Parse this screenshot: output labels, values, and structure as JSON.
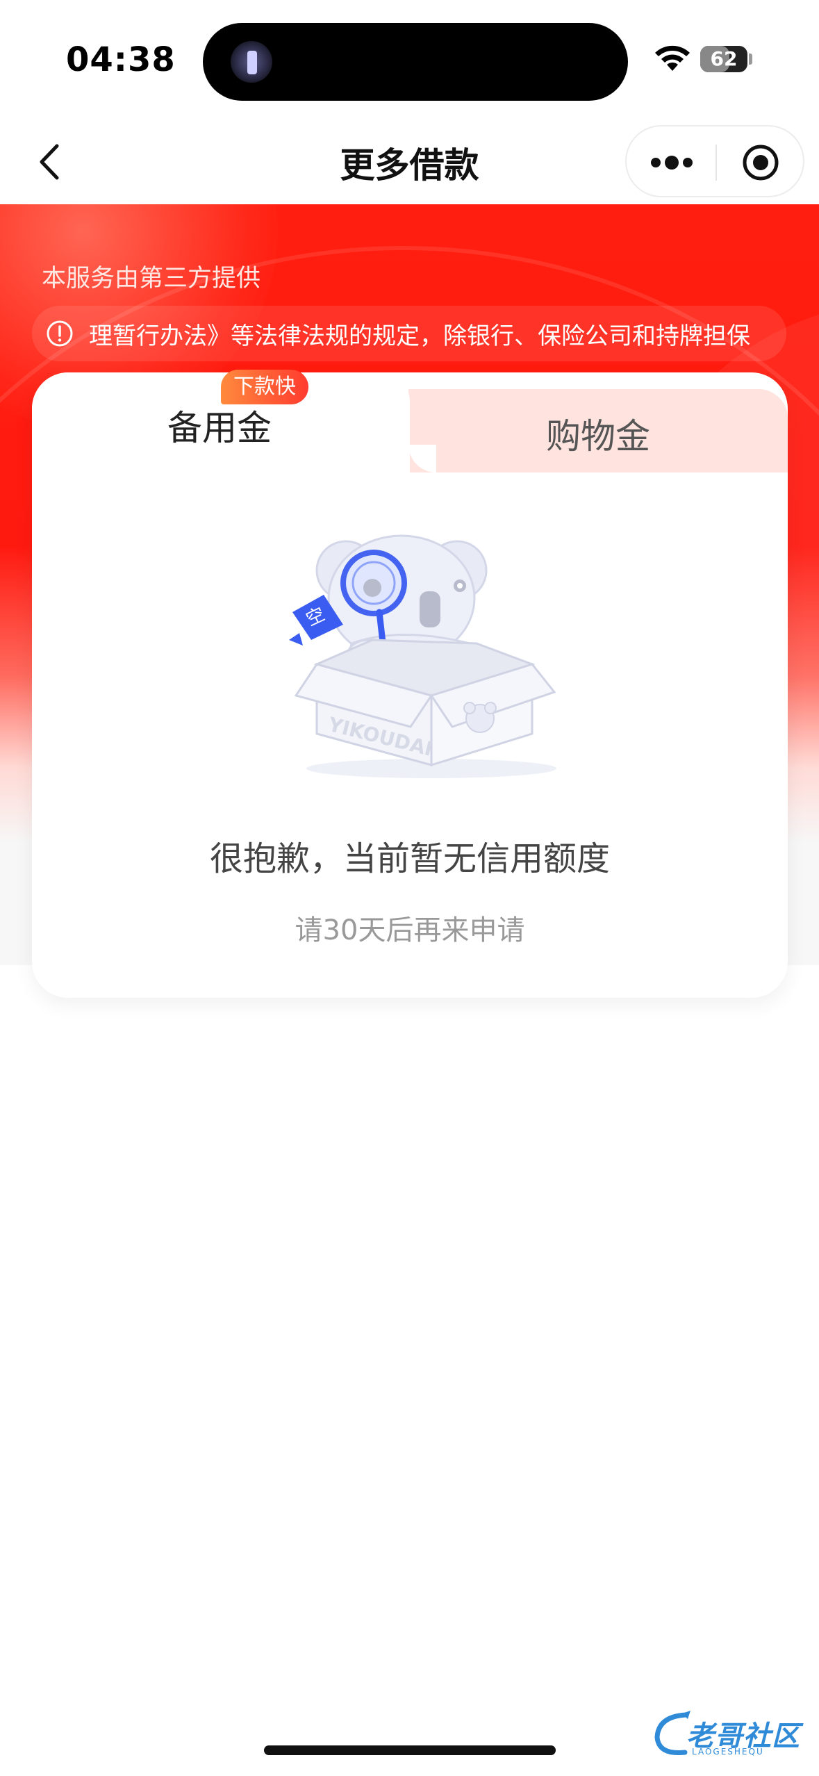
{
  "status_bar": {
    "time": "04:38",
    "battery": "62",
    "battery_level": 0.62,
    "icons": [
      "flashlight-icon",
      "wifi-icon",
      "battery-icon"
    ]
  },
  "navbar": {
    "title": "更多借款",
    "icons": [
      "back-chevron-icon",
      "more-dots-icon",
      "target-icon"
    ]
  },
  "hero": {
    "provider_text": "本服务由第三方提供",
    "notice_text": "理暂行办法》等法律法规的规定，除银行、保险公司和持牌担保",
    "notice_icon": "warning-circle-icon"
  },
  "tabs": [
    {
      "label": "备用金",
      "badge": "下款快",
      "active": true
    },
    {
      "label": "购物金",
      "active": false
    }
  ],
  "empty_state": {
    "illustration": "koala-in-box-icon",
    "box_text": "YIKOUDAI",
    "speech_tag": "空",
    "title": "很抱歉，当前暂无信用额度",
    "subtitle": "请30天后再来申请"
  },
  "watermark": {
    "text": "老哥社区",
    "subtext": "LAOGESHEQU"
  },
  "colors": {
    "hero_red": "#ff1e0f",
    "tab_inactive": "#ffe3df",
    "badge_start": "#ff8a3d",
    "badge_end": "#ff3b2f",
    "illustration_blue": "#3a5cf0"
  }
}
